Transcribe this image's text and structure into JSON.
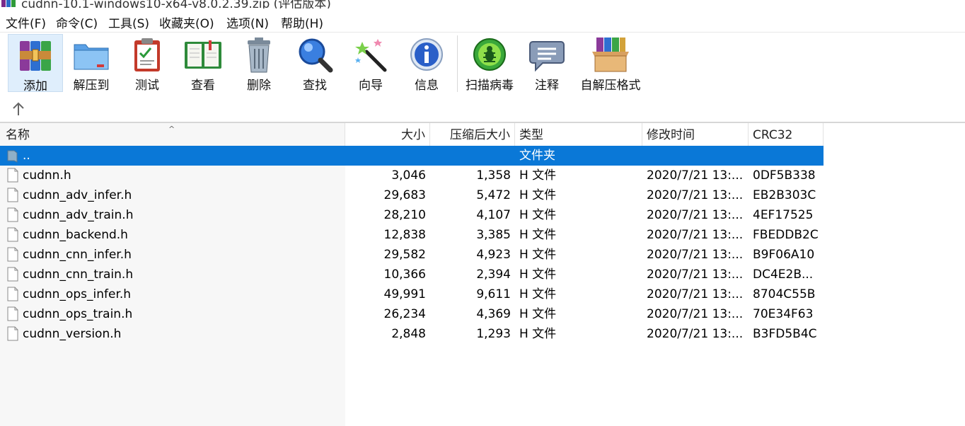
{
  "window": {
    "title": "cudnn-10.1-windows10-x64-v8.0.2.39.zip (评估版本)"
  },
  "menu": [
    {
      "label": "文件(F)"
    },
    {
      "label": "命令(C)"
    },
    {
      "label": "工具(S)"
    },
    {
      "label": "收藏夹(O)"
    },
    {
      "label": "选项(N)"
    },
    {
      "label": "帮助(H)"
    }
  ],
  "toolbar": [
    {
      "label": "添加",
      "icon": "add-archive-icon"
    },
    {
      "label": "解压到",
      "icon": "extract-folder-icon"
    },
    {
      "label": "测试",
      "icon": "test-clipboard-icon"
    },
    {
      "label": "查看",
      "icon": "view-book-icon"
    },
    {
      "label": "删除",
      "icon": "trash-icon"
    },
    {
      "label": "查找",
      "icon": "magnifier-icon"
    },
    {
      "label": "向导",
      "icon": "wizard-wand-icon"
    },
    {
      "label": "信息",
      "icon": "info-icon"
    },
    {
      "label": "扫描病毒",
      "icon": "virus-scan-icon"
    },
    {
      "label": "注释",
      "icon": "comment-icon"
    },
    {
      "label": "自解压格式",
      "icon": "sfx-box-icon"
    }
  ],
  "columns": {
    "name": "名称",
    "size": "大小",
    "packed": "压缩后大小",
    "type": "类型",
    "modified": "修改时间",
    "crc": "CRC32"
  },
  "parent_row": {
    "name": "..",
    "type": "文件夹"
  },
  "files": [
    {
      "name": "cudnn.h",
      "size": "3,046",
      "packed": "1,358",
      "type": "H 文件",
      "modified": "2020/7/21 13:...",
      "crc": "0DF5B338"
    },
    {
      "name": "cudnn_adv_infer.h",
      "size": "29,683",
      "packed": "5,472",
      "type": "H 文件",
      "modified": "2020/7/21 13:...",
      "crc": "EB2B303C"
    },
    {
      "name": "cudnn_adv_train.h",
      "size": "28,210",
      "packed": "4,107",
      "type": "H 文件",
      "modified": "2020/7/21 13:...",
      "crc": "4EF17525"
    },
    {
      "name": "cudnn_backend.h",
      "size": "12,838",
      "packed": "3,385",
      "type": "H 文件",
      "modified": "2020/7/21 13:...",
      "crc": "FBEDDB2C"
    },
    {
      "name": "cudnn_cnn_infer.h",
      "size": "29,582",
      "packed": "4,923",
      "type": "H 文件",
      "modified": "2020/7/21 13:...",
      "crc": "B9F06A10"
    },
    {
      "name": "cudnn_cnn_train.h",
      "size": "10,366",
      "packed": "2,394",
      "type": "H 文件",
      "modified": "2020/7/21 13:...",
      "crc": "DC4E2B..."
    },
    {
      "name": "cudnn_ops_infer.h",
      "size": "49,991",
      "packed": "9,611",
      "type": "H 文件",
      "modified": "2020/7/21 13:...",
      "crc": "8704C55B"
    },
    {
      "name": "cudnn_ops_train.h",
      "size": "26,234",
      "packed": "4,369",
      "type": "H 文件",
      "modified": "2020/7/21 13:...",
      "crc": "70E34F63"
    },
    {
      "name": "cudnn_version.h",
      "size": "2,848",
      "packed": "1,293",
      "type": "H 文件",
      "modified": "2020/7/21 13:...",
      "crc": "B3FD5B4C"
    }
  ],
  "colors": {
    "selection": "#0a78d7",
    "accent_highlight": "#dfeefc"
  }
}
